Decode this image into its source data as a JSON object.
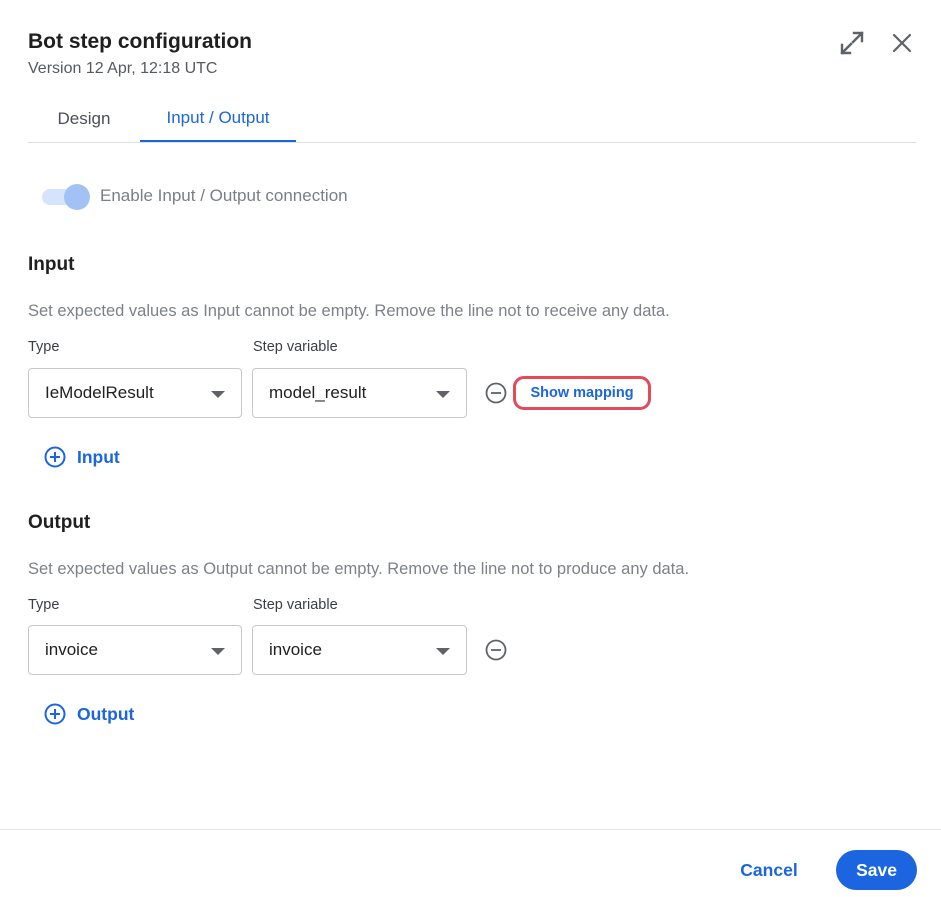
{
  "header": {
    "title": "Bot step configuration",
    "subtitle": "Version 12 Apr, 12:18 UTC",
    "expand_icon": "expand-icon",
    "close_icon": "close-icon"
  },
  "tabs": [
    {
      "label": "Design",
      "active": false
    },
    {
      "label": "Input / Output",
      "active": true
    }
  ],
  "toggle": {
    "label": "Enable Input / Output connection",
    "enabled": true
  },
  "input_section": {
    "title": "Input",
    "description": "Set expected values as Input cannot be empty. Remove the line not to receive any data.",
    "type_label": "Type",
    "variable_label": "Step variable",
    "rows": [
      {
        "type": "IeModelResult",
        "variable": "model_result",
        "show_mapping_label": "Show mapping"
      }
    ],
    "add_label": "Input"
  },
  "output_section": {
    "title": "Output",
    "description": "Set expected values as Output cannot be empty. Remove the line not to produce any data.",
    "type_label": "Type",
    "variable_label": "Step variable",
    "rows": [
      {
        "type": "invoice",
        "variable": "invoice"
      }
    ],
    "add_label": "Output"
  },
  "footer": {
    "cancel_label": "Cancel",
    "save_label": "Save"
  },
  "colors": {
    "accent": "#1b66e0",
    "highlight": "#e34b5a"
  }
}
